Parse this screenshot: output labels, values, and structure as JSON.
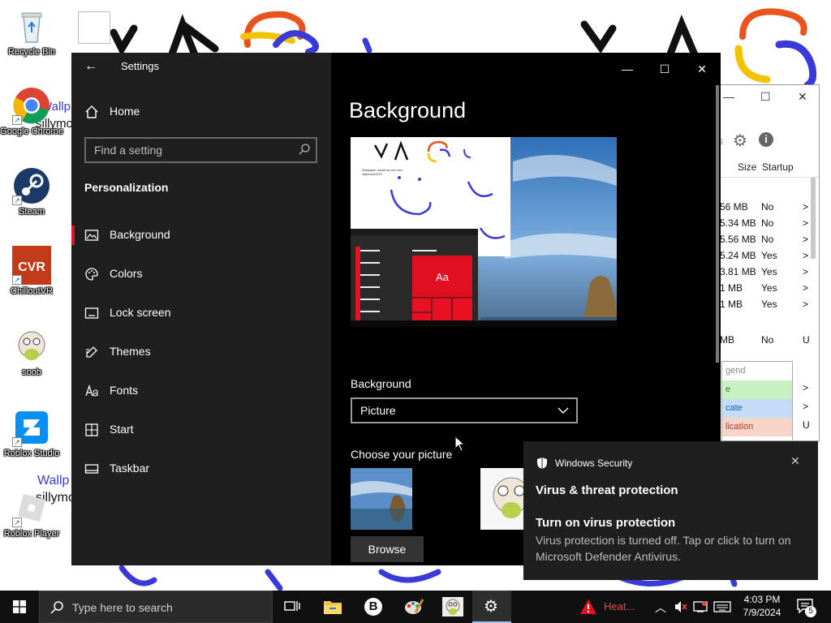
{
  "desktop": {
    "wallpaper_text": [
      "Wallp",
      "sillymo",
      "Wallp",
      "sillymo"
    ],
    "icons": [
      {
        "label": "Recycle Bin",
        "icon": "recycle-bin-icon"
      },
      {
        "label": "Google Chrome",
        "icon": "chrome-icon"
      },
      {
        "label": "Steam",
        "icon": "steam-icon"
      },
      {
        "label": "ChilloutVR",
        "icon": "chilloutvr-icon"
      },
      {
        "label": "soob",
        "icon": "soob-icon"
      },
      {
        "label": "Roblox Studio",
        "icon": "roblox-studio-icon"
      },
      {
        "label": "Roblox Player",
        "icon": "roblox-player-icon"
      }
    ]
  },
  "taskmgr": {
    "columns": {
      "size": "Size",
      "startup": "Startup"
    },
    "rows": [
      {
        "size": "56 MB",
        "startup": "No",
        "tail": ">"
      },
      {
        "size": "5.34 MB",
        "startup": "No",
        "tail": ">"
      },
      {
        "size": "5.56 MB",
        "startup": "No",
        "tail": ">"
      },
      {
        "size": "5.24 MB",
        "startup": "Yes",
        "tail": ">"
      },
      {
        "size": "3.81 MB",
        "startup": "Yes",
        "tail": ">"
      },
      {
        "size": "1 MB",
        "startup": "Yes",
        "tail": ">"
      },
      {
        "size": "1 MB",
        "startup": "Yes",
        "tail": ">"
      },
      {
        "size": "MB",
        "startup": "No",
        "tail": "U"
      }
    ],
    "legend": [
      "gend",
      "e",
      "cate",
      "lication"
    ],
    "legend_tails": [
      ">",
      ">",
      "U",
      ">",
      ">"
    ],
    "partial_label": "s"
  },
  "settings": {
    "title": "Settings",
    "search_placeholder": "Find a setting",
    "home_label": "Home",
    "section_label": "Personalization",
    "nav": [
      {
        "label": "Background",
        "icon": "picture-icon",
        "active": true
      },
      {
        "label": "Colors",
        "icon": "palette-icon"
      },
      {
        "label": "Lock screen",
        "icon": "lock-screen-icon"
      },
      {
        "label": "Themes",
        "icon": "brush-icon"
      },
      {
        "label": "Fonts",
        "icon": "fonts-icon"
      },
      {
        "label": "Start",
        "icon": "start-icon"
      },
      {
        "label": "Taskbar",
        "icon": "taskbar-icon"
      }
    ],
    "page_title": "Background",
    "preview": {
      "tile_text": "Aa",
      "small_text": "Wallpaper made by cee wnv\nsillymoss3141"
    },
    "background_label": "Background",
    "background_value": "Picture",
    "choose_label": "Choose your picture",
    "browse_label": "Browse"
  },
  "toast": {
    "app": "Windows Security",
    "heading": "Virus & threat protection",
    "title": "Turn on virus protection",
    "body": "Virus protection is turned off. Tap or click to turn on Microsoft Defender Antivirus."
  },
  "taskbar": {
    "search_placeholder": "Type here to search",
    "heat_label": "Heat...",
    "time": "4:03 PM",
    "date": "7/9/2024",
    "notification_count": "5"
  },
  "colors": {
    "accent": "#e81123",
    "nav_bg": "#1f1f1f",
    "content_bg": "#000000",
    "toast_bg": "#1f1f1f"
  }
}
